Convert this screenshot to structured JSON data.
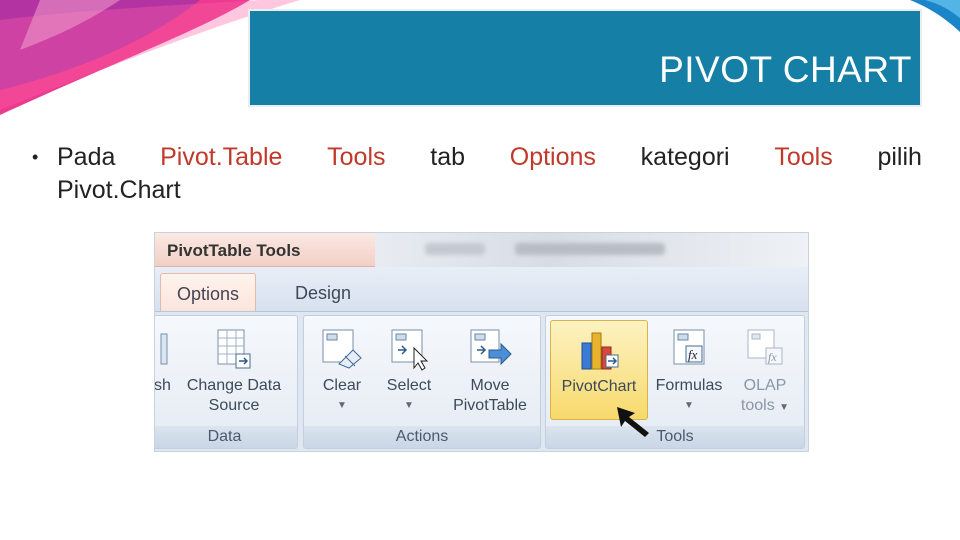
{
  "slide": {
    "title": "PIVOT CHART",
    "bullet": {
      "marker": "•",
      "words": [
        "Pada",
        "Pivot.Table",
        "Tools",
        "tab",
        "Options",
        "kategori",
        "Tools",
        "pilih"
      ],
      "line2": "Pivot.Chart"
    }
  },
  "ribbon": {
    "context_tab": "PivotTable Tools",
    "tabs": [
      "Options",
      "Design"
    ],
    "groups": {
      "data": {
        "label": "Data",
        "partial_label": "sh",
        "change_data_source": [
          "Change Data",
          "Source"
        ]
      },
      "actions": {
        "label": "Actions",
        "clear": "Clear",
        "select": "Select",
        "move": [
          "Move",
          "PivotTable"
        ]
      },
      "tools": {
        "label": "Tools",
        "pivotchart": "PivotChart",
        "formulas": "Formulas",
        "olap": [
          "OLAP",
          "tools"
        ]
      }
    }
  },
  "colors": {
    "title_bg": "#157fa6",
    "highlight_text": "#c0392b",
    "selected_button": "#f7d96c"
  }
}
